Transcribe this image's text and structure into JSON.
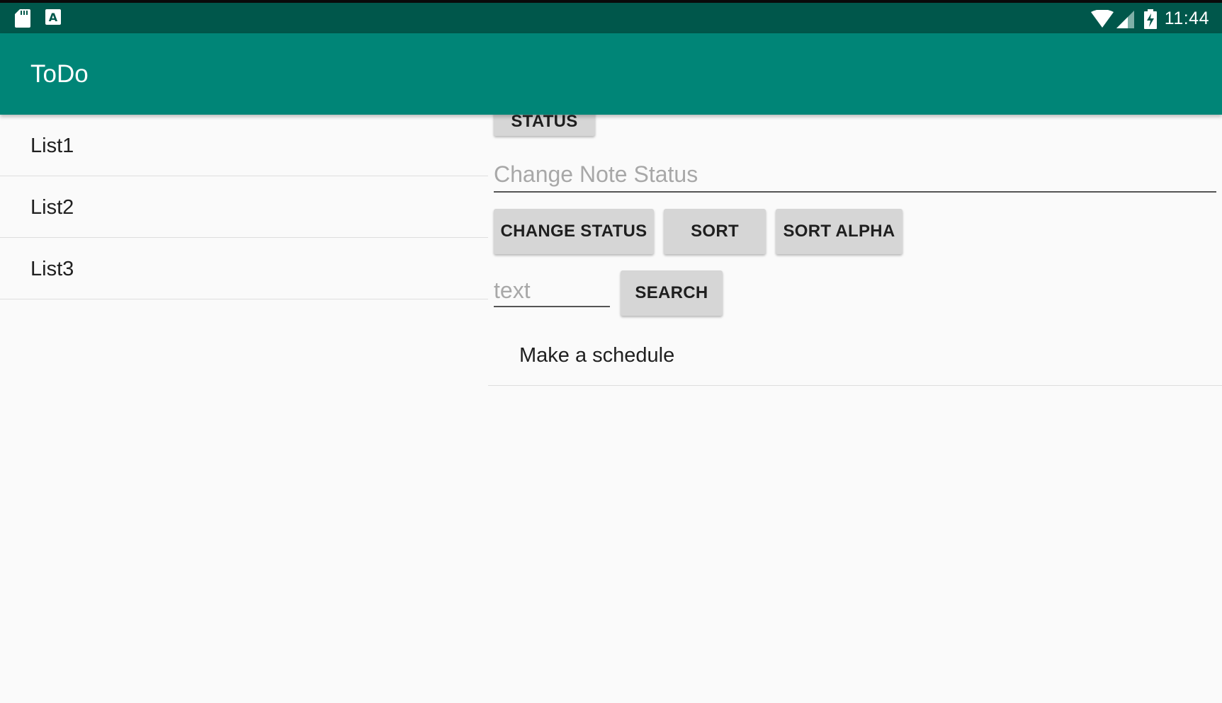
{
  "status_bar": {
    "time": "11:44",
    "icons": [
      "sd-card-icon",
      "keyboard-a-icon",
      "wifi-icon",
      "cell-signal-icon",
      "battery-charging-icon"
    ]
  },
  "app_bar": {
    "title": "ToDo",
    "color": "#008577"
  },
  "lists": [
    {
      "label": "List1"
    },
    {
      "label": "List2"
    },
    {
      "label": "List3"
    }
  ],
  "controls": {
    "status_button_label": "STATUS",
    "note_status_placeholder": "Change Note Status",
    "change_status_label": "CHANGE STATUS",
    "sort_label": "SORT",
    "sort_alpha_label": "SORT ALPHA",
    "search_placeholder": "text",
    "search_label": "SEARCH"
  },
  "notes": [
    {
      "label": "Make a schedule"
    }
  ]
}
